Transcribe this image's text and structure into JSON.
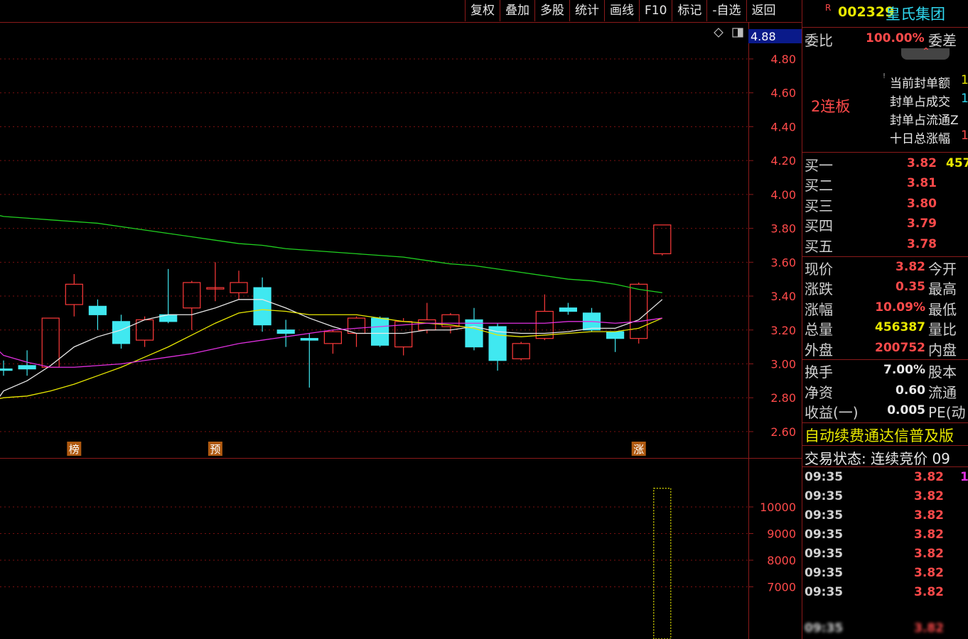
{
  "toolbar": [
    "复权",
    "叠加",
    "多股",
    "统计",
    "画线",
    "F10",
    "标记",
    "-自选",
    "返回"
  ],
  "stock": {
    "badge": "R",
    "code": "002329",
    "name": "皇氏集团"
  },
  "price_cursor": "4.88",
  "price_axis": [
    "4.80",
    "4.60",
    "4.40",
    "4.20",
    "4.00",
    "3.80",
    "3.60",
    "3.40",
    "3.20",
    "3.00",
    "2.80",
    "2.60"
  ],
  "volume_axis": [
    "10000",
    "9000",
    "8000",
    "7000"
  ],
  "markers": [
    "榜",
    "预",
    "涨"
  ],
  "weibi": {
    "label": "委比",
    "value": "100.00%",
    "label2": "委差"
  },
  "limit_up": {
    "streak": "2连板",
    "items": [
      "当前封单额",
      "封单占成交",
      "封单占流通Z",
      "十日总涨幅"
    ],
    "item_values": [
      "1",
      "1",
      "",
      "1"
    ]
  },
  "bids": [
    {
      "label": "买一",
      "price": "3.82",
      "vol": "457"
    },
    {
      "label": "买二",
      "price": "3.81",
      "vol": ""
    },
    {
      "label": "买三",
      "price": "3.80",
      "vol": ""
    },
    {
      "label": "买四",
      "price": "3.79",
      "vol": ""
    },
    {
      "label": "买五",
      "price": "3.78",
      "vol": ""
    }
  ],
  "quote": [
    {
      "label": "现价",
      "value": "3.82",
      "label2": "今开"
    },
    {
      "label": "涨跌",
      "value": "0.35",
      "label2": "最高"
    },
    {
      "label": "涨幅",
      "value": "10.09%",
      "label2": "最低"
    },
    {
      "label": "总量",
      "value": "456387",
      "label2": "量比"
    },
    {
      "label": "外盘",
      "value": "200752",
      "label2": "内盘"
    }
  ],
  "fundamentals": [
    {
      "label": "换手",
      "value": "7.00%",
      "label2": "股本"
    },
    {
      "label": "净资",
      "value": "0.60",
      "label2": "流通"
    },
    {
      "label": "收益(一)",
      "value": "0.005",
      "label2": "PE(动"
    }
  ],
  "ticker": "自动续费通达信普及版",
  "trade_status": "交易状态: 连续竞价 09",
  "ticks": [
    {
      "time": "09:35",
      "price": "3.82",
      "vol": "1"
    },
    {
      "time": "09:35",
      "price": "3.82",
      "vol": ""
    },
    {
      "time": "09:35",
      "price": "3.82",
      "vol": ""
    },
    {
      "time": "09:35",
      "price": "3.82",
      "vol": ""
    },
    {
      "time": "09:35",
      "price": "3.82",
      "vol": ""
    },
    {
      "time": "09:35",
      "price": "3.82",
      "vol": ""
    },
    {
      "time": "09:35",
      "price": "3.82",
      "vol": ""
    },
    {
      "time": "09:35",
      "price": "3.82",
      "vol": ""
    }
  ],
  "chart_data": {
    "type": "candlestick",
    "ylim": [
      2.6,
      4.8
    ],
    "candles": [
      {
        "o": 2.97,
        "c": 2.97,
        "h": 3.02,
        "l": 2.93,
        "dir": "down"
      },
      {
        "o": 2.99,
        "c": 2.97,
        "h": 3.08,
        "l": 2.93,
        "dir": "down"
      },
      {
        "o": 2.98,
        "c": 3.27,
        "h": 3.27,
        "l": 2.98,
        "dir": "up"
      },
      {
        "o": 3.35,
        "c": 3.47,
        "h": 3.53,
        "l": 3.28,
        "dir": "up"
      },
      {
        "o": 3.34,
        "c": 3.29,
        "h": 3.38,
        "l": 3.2,
        "dir": "down"
      },
      {
        "o": 3.25,
        "c": 3.12,
        "h": 3.29,
        "l": 3.09,
        "dir": "down"
      },
      {
        "o": 3.14,
        "c": 3.26,
        "h": 3.28,
        "l": 3.1,
        "dir": "up"
      },
      {
        "o": 3.29,
        "c": 3.25,
        "h": 3.56,
        "l": 3.24,
        "dir": "down"
      },
      {
        "o": 3.33,
        "c": 3.48,
        "h": 3.49,
        "l": 3.2,
        "dir": "up"
      },
      {
        "o": 3.45,
        "c": 3.45,
        "h": 3.6,
        "l": 3.37,
        "dir": "up"
      },
      {
        "o": 3.42,
        "c": 3.48,
        "h": 3.55,
        "l": 3.38,
        "dir": "up"
      },
      {
        "o": 3.45,
        "c": 3.23,
        "h": 3.51,
        "l": 3.19,
        "dir": "down"
      },
      {
        "o": 3.2,
        "c": 3.18,
        "h": 3.26,
        "l": 3.1,
        "dir": "down"
      },
      {
        "o": 3.15,
        "c": 3.14,
        "h": 3.18,
        "l": 2.86,
        "dir": "down"
      },
      {
        "o": 3.12,
        "c": 3.19,
        "h": 3.2,
        "l": 3.06,
        "dir": "up"
      },
      {
        "o": 3.18,
        "c": 3.27,
        "h": 3.28,
        "l": 3.1,
        "dir": "up"
      },
      {
        "o": 3.27,
        "c": 3.11,
        "h": 3.28,
        "l": 3.1,
        "dir": "down"
      },
      {
        "o": 3.1,
        "c": 3.25,
        "h": 3.27,
        "l": 3.05,
        "dir": "up"
      },
      {
        "o": 3.2,
        "c": 3.26,
        "h": 3.36,
        "l": 3.18,
        "dir": "up"
      },
      {
        "o": 3.22,
        "c": 3.29,
        "h": 3.3,
        "l": 3.18,
        "dir": "up"
      },
      {
        "o": 3.26,
        "c": 3.1,
        "h": 3.33,
        "l": 3.08,
        "dir": "down"
      },
      {
        "o": 3.22,
        "c": 3.02,
        "h": 3.24,
        "l": 2.96,
        "dir": "down"
      },
      {
        "o": 3.03,
        "c": 3.12,
        "h": 3.13,
        "l": 3.02,
        "dir": "up"
      },
      {
        "o": 3.15,
        "c": 3.31,
        "h": 3.41,
        "l": 3.14,
        "dir": "up"
      },
      {
        "o": 3.33,
        "c": 3.31,
        "h": 3.36,
        "l": 3.29,
        "dir": "down"
      },
      {
        "o": 3.3,
        "c": 3.2,
        "h": 3.33,
        "l": 3.19,
        "dir": "down"
      },
      {
        "o": 3.19,
        "c": 3.15,
        "h": 3.19,
        "l": 3.07,
        "dir": "down"
      },
      {
        "o": 3.15,
        "c": 3.47,
        "h": 3.48,
        "l": 3.12,
        "dir": "up"
      },
      {
        "o": 3.65,
        "c": 3.82,
        "h": 3.82,
        "l": 3.64,
        "dir": "up"
      }
    ],
    "ma": [
      {
        "color": "#e8e8e8",
        "values": [
          2.84,
          2.9,
          2.99,
          3.1,
          3.16,
          3.2,
          3.26,
          3.29,
          3.29,
          3.33,
          3.38,
          3.38,
          3.33,
          3.27,
          3.22,
          3.18,
          3.18,
          3.18,
          3.2,
          3.2,
          3.22,
          3.19,
          3.18,
          3.18,
          3.19,
          3.21,
          3.21,
          3.26,
          3.38
        ]
      },
      {
        "color": "#e8e800",
        "values": [
          2.8,
          2.81,
          2.84,
          2.88,
          2.93,
          2.98,
          3.04,
          3.1,
          3.17,
          3.24,
          3.3,
          3.32,
          3.31,
          3.29,
          3.29,
          3.29,
          3.27,
          3.25,
          3.24,
          3.23,
          3.21,
          3.17,
          3.16,
          3.17,
          3.18,
          3.19,
          3.19,
          3.21,
          3.27
        ]
      },
      {
        "color": "#e030e0",
        "values": [
          3.05,
          3.01,
          2.98,
          2.98,
          2.99,
          3.0,
          3.02,
          3.04,
          3.06,
          3.09,
          3.12,
          3.14,
          3.16,
          3.18,
          3.2,
          3.21,
          3.22,
          3.23,
          3.24,
          3.24,
          3.24,
          3.24,
          3.24,
          3.24,
          3.25,
          3.25,
          3.24,
          3.25,
          3.27
        ]
      },
      {
        "color": "#20d020",
        "values": [
          3.87,
          3.86,
          3.85,
          3.84,
          3.83,
          3.81,
          3.79,
          3.77,
          3.75,
          3.73,
          3.71,
          3.7,
          3.68,
          3.67,
          3.66,
          3.65,
          3.64,
          3.63,
          3.61,
          3.59,
          3.58,
          3.56,
          3.54,
          3.52,
          3.5,
          3.49,
          3.47,
          3.44,
          3.42
        ]
      }
    ],
    "volume": {
      "ylim": [
        5500,
        11000
      ],
      "last": 10700
    }
  }
}
